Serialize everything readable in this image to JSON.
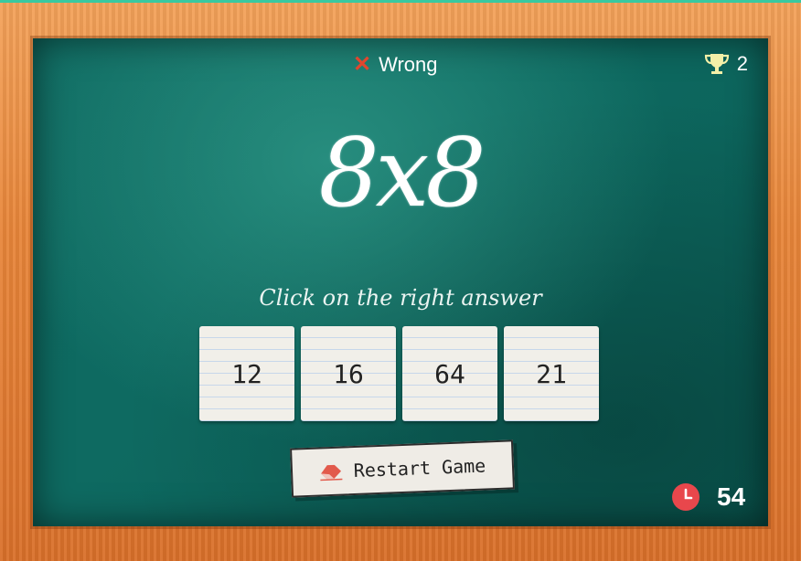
{
  "status": {
    "text": "Wrong",
    "icon": "x-icon",
    "color": "#e0462e"
  },
  "score": {
    "icon": "trophy-icon",
    "value": "2"
  },
  "question": "8x8",
  "instruction": "Click on the right answer",
  "answers": [
    "12",
    "16",
    "64",
    "21"
  ],
  "restart": {
    "label": "Restart Game",
    "icon": "eraser-icon"
  },
  "timer": {
    "icon": "clock-icon",
    "value": "54",
    "icon_color": "#e8474c"
  }
}
